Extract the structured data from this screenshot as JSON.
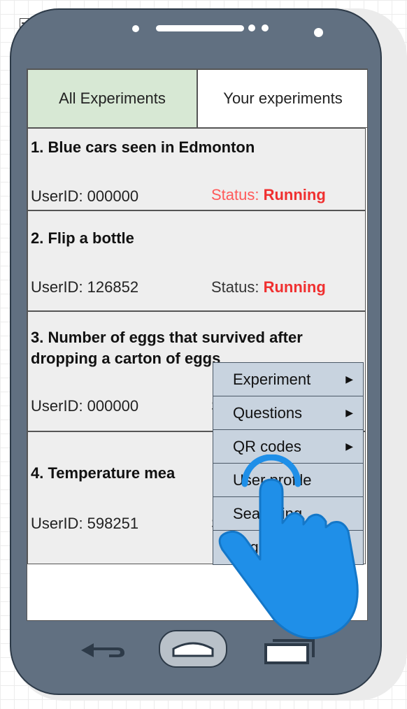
{
  "tabs": [
    {
      "label": "All Experiments",
      "selected": true
    },
    {
      "label": "Your experiments",
      "selected": false
    }
  ],
  "experiments": [
    {
      "title": "1. Blue cars seen in Edmonton",
      "user": "UserID: 000000",
      "status_prefix": "Status: ",
      "status_value": "Running"
    },
    {
      "title": "2. Flip a bottle",
      "user": "UserID: 126852",
      "status_prefix": "Status: ",
      "status_value": "Running"
    },
    {
      "title": "3. Number of eggs that survived after dropping a carton of eggs",
      "user": "UserID: 000000",
      "status_prefix": "S",
      "status_value": ""
    },
    {
      "title": "4. Temperature mea",
      "user": "UserID: 598251",
      "status_prefix": "S",
      "status_value": ""
    }
  ],
  "menu": {
    "items": [
      {
        "label": "Experiment",
        "submenu": true
      },
      {
        "label": "Questions",
        "submenu": true
      },
      {
        "label": "QR codes",
        "submenu": true
      },
      {
        "label": "User profile",
        "submenu": false
      },
      {
        "label": "Searching",
        "submenu": false
      },
      {
        "label": "Logout",
        "submenu": false
      }
    ],
    "arrow_glyph": "▶"
  },
  "colors": {
    "phone_body": "#617081",
    "tab_selected": "#d7e8d4",
    "status_running": "#f03030",
    "menu_bg": "#c8d3df",
    "hand_cursor": "#1f8fe8"
  },
  "icons": {
    "cursor": "hand-tap-icon",
    "nav": [
      "back-arrow-icon",
      "home-icon",
      "recent-apps-icon"
    ]
  }
}
